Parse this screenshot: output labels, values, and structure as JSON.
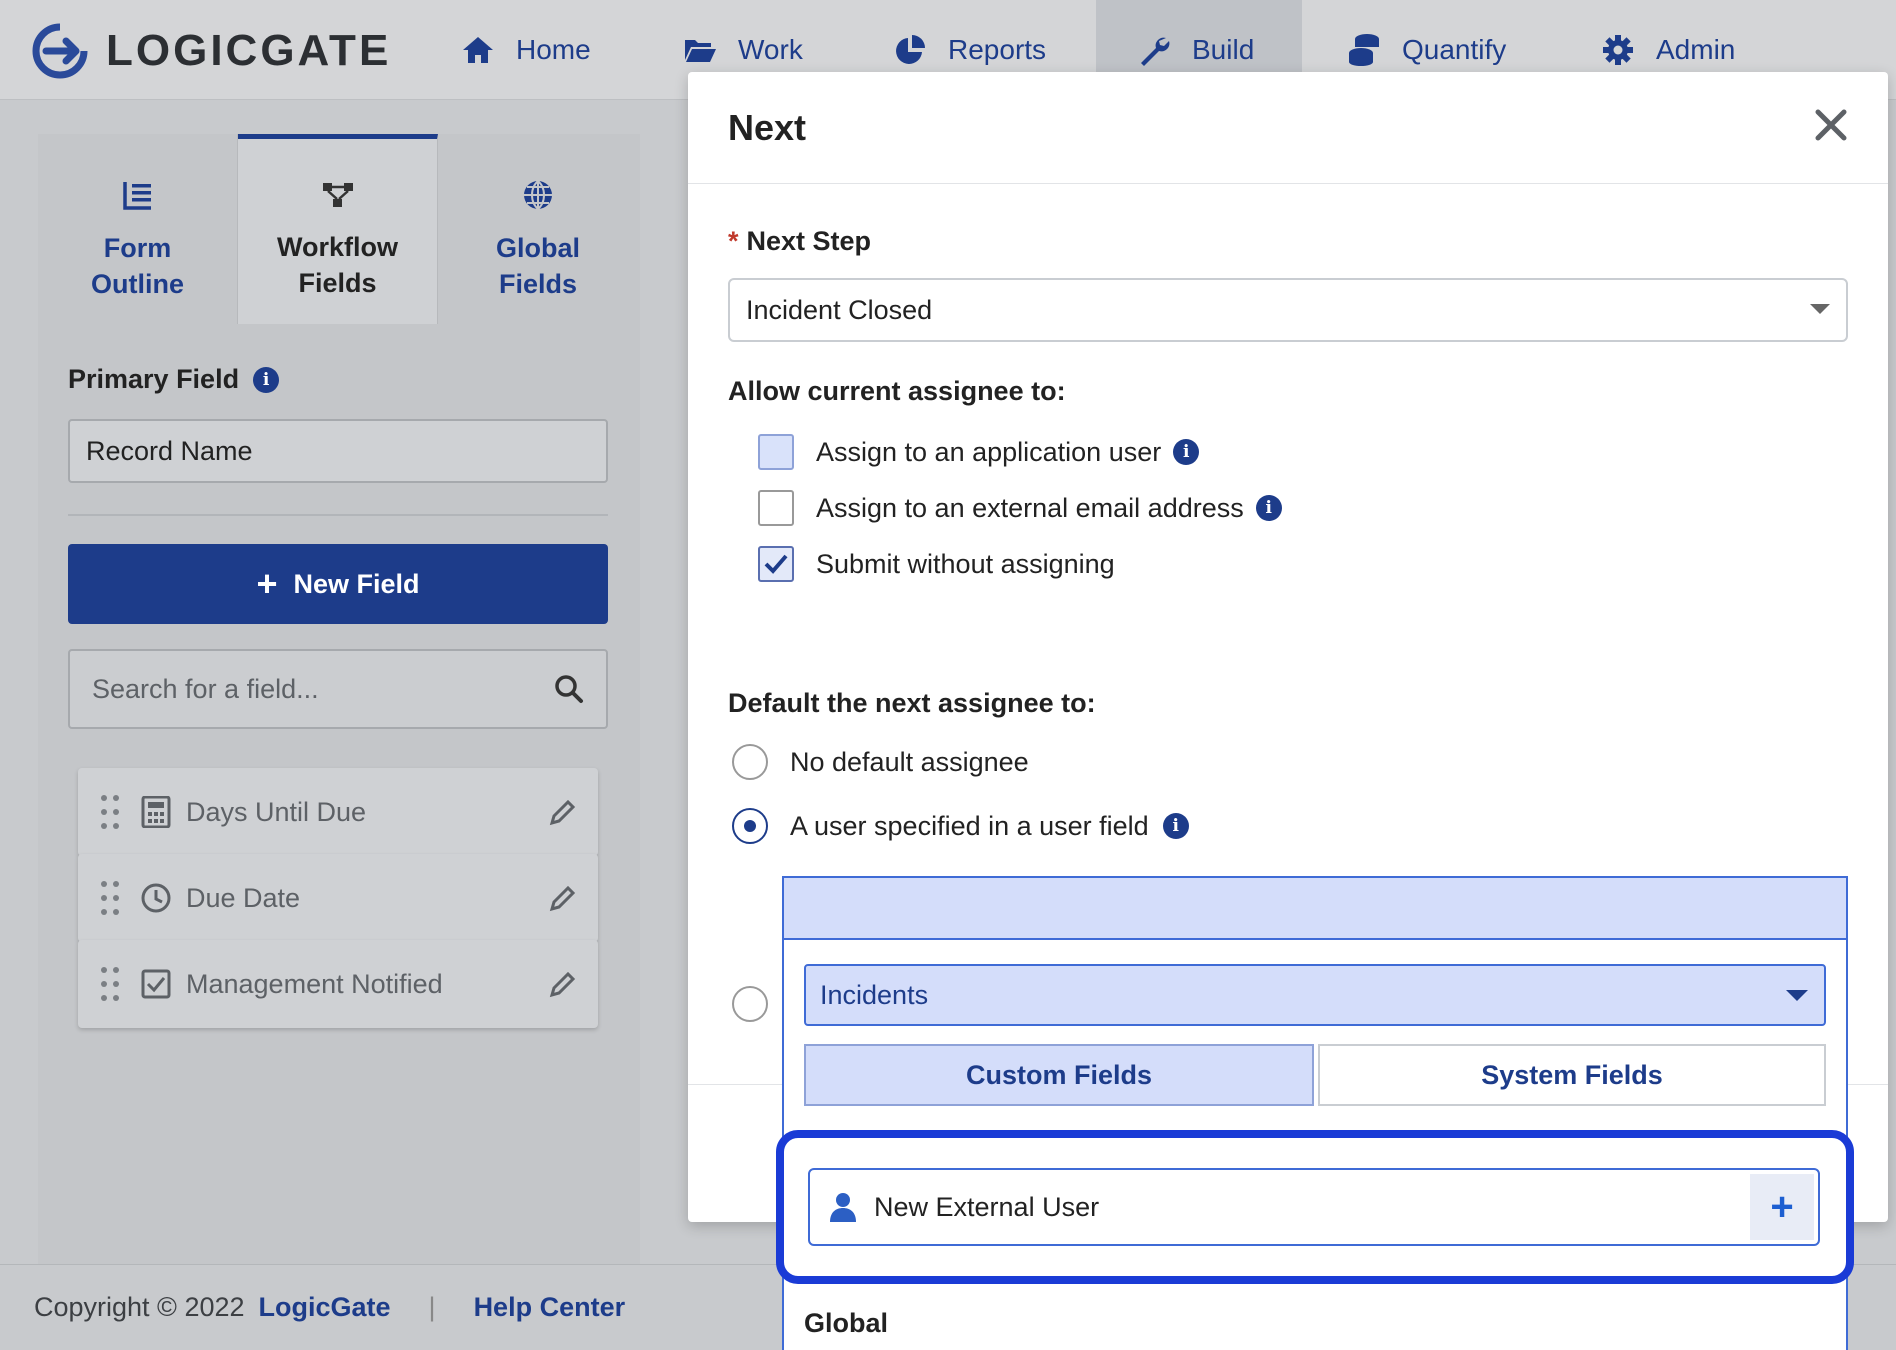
{
  "brand": {
    "name": "LOGICGATE"
  },
  "nav": {
    "items": [
      {
        "label": "Home",
        "icon": "home-icon"
      },
      {
        "label": "Work",
        "icon": "folder-open-icon"
      },
      {
        "label": "Reports",
        "icon": "pie-chart-icon"
      },
      {
        "label": "Build",
        "icon": "wrench-icon",
        "active": true
      },
      {
        "label": "Quantify",
        "icon": "coins-icon"
      },
      {
        "label": "Admin",
        "icon": "gear-icon"
      }
    ]
  },
  "sidebar": {
    "tabs": [
      {
        "label_line1": "Form",
        "label_line2": "Outline",
        "icon": "list-outline-icon"
      },
      {
        "label_line1": "Workflow",
        "label_line2": "Fields",
        "icon": "workflow-icon",
        "active": true
      },
      {
        "label_line1": "Global",
        "label_line2": "Fields",
        "icon": "globe-icon"
      }
    ],
    "primary_field_label": "Primary Field",
    "primary_field_value": "Record Name",
    "new_field_label": "New Field",
    "search_placeholder": "Search for a field...",
    "fields": [
      {
        "label": "Days Until Due",
        "icon": "calculator-icon"
      },
      {
        "label": "Due Date",
        "icon": "clock-icon"
      },
      {
        "label": "Management Notified",
        "icon": "checkbox-icon"
      }
    ]
  },
  "footer": {
    "copyright": "Copyright © 2022",
    "brand_link": "LogicGate",
    "separator": "|",
    "help_link": "Help Center"
  },
  "modal": {
    "title": "Next",
    "next_step_label": "Next Step",
    "next_step_required_mark": "*",
    "next_step_value": "Incident Closed",
    "allow_label": "Allow current assignee to:",
    "allow_options": [
      {
        "label": "Assign to an application user",
        "checked": false,
        "info": true
      },
      {
        "label": "Assign to an external email address",
        "checked": false,
        "info": true
      },
      {
        "label": "Submit without assigning",
        "checked": true,
        "info": false
      }
    ],
    "default_label": "Default the next assignee to:",
    "default_options": [
      {
        "label": "No default assignee",
        "selected": false,
        "info": false
      },
      {
        "label": "A user specified in a user field",
        "selected": true,
        "info": true
      }
    ]
  },
  "dropdown": {
    "selected_app": "Incidents",
    "tabs": [
      {
        "label": "Custom Fields",
        "active": true
      },
      {
        "label": "System Fields",
        "active": false
      }
    ],
    "option_new_external_user": "New External User",
    "add_symbol": "+",
    "section_global": "Global"
  },
  "colors": {
    "brand_blue": "#1d3c8a",
    "highlight_blue": "#1a3bd6",
    "selected_fill": "#d4ddfa"
  }
}
